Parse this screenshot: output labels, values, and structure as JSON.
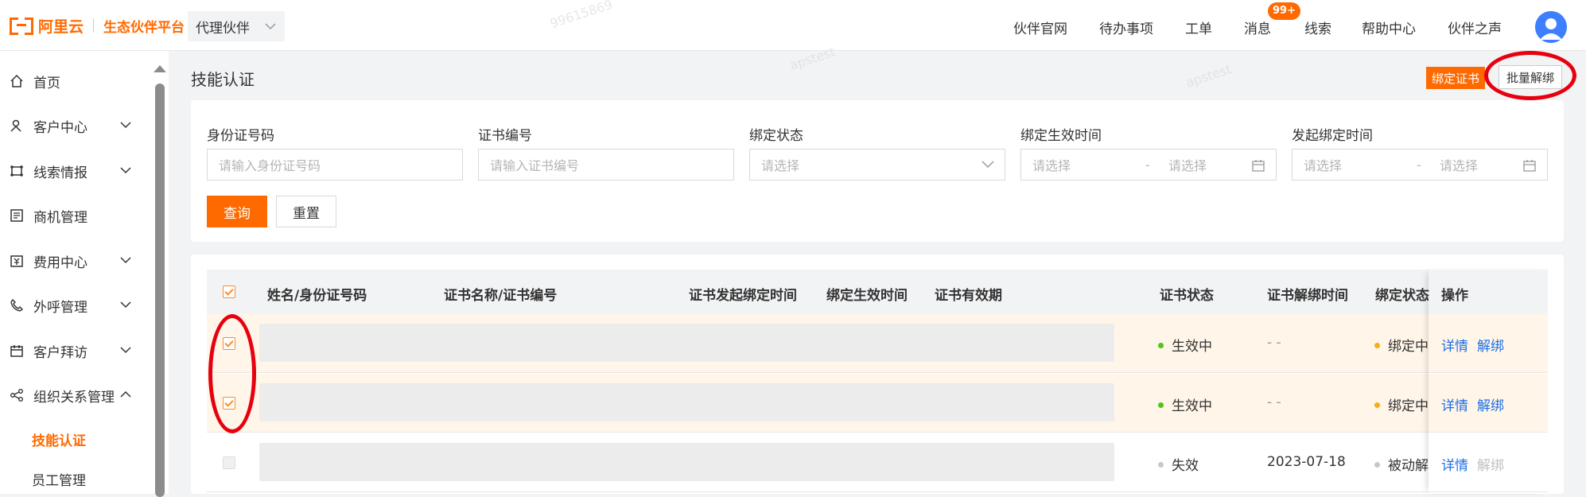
{
  "header": {
    "logo_text": "阿里云",
    "logo_sub": "生态伙伴平台",
    "role": "代理伙伴",
    "nav": [
      "伙伴官网",
      "待办事项",
      "工单",
      "消息",
      "线索",
      "帮助中心",
      "伙伴之声"
    ],
    "message_badge": "99+"
  },
  "sidebar": {
    "items": [
      {
        "label": "首页",
        "icon": "home-icon"
      },
      {
        "label": "客户中心",
        "icon": "customer-icon"
      },
      {
        "label": "线索情报",
        "icon": "lead-icon"
      },
      {
        "label": "商机管理",
        "icon": "opportunity-icon"
      },
      {
        "label": "费用中心",
        "icon": "fee-icon"
      },
      {
        "label": "外呼管理",
        "icon": "phone-icon"
      },
      {
        "label": "客户拜访",
        "icon": "calendar-icon"
      },
      {
        "label": "组织关系管理",
        "icon": "share-icon"
      }
    ],
    "sub_items": [
      "技能认证",
      "员工管理"
    ]
  },
  "page": {
    "title": "技能认证",
    "bind_cert_label": "绑定证书",
    "batch_unbind_label": "批量解绑"
  },
  "filters": {
    "id_label": "身份证号码",
    "id_placeholder": "请输入身份证号码",
    "cert_label": "证书编号",
    "cert_placeholder": "请输入证书编号",
    "status_label": "绑定状态",
    "status_placeholder": "请选择",
    "effective_label": "绑定生效时间",
    "initiate_label": "发起绑定时间",
    "range_start": "请选择",
    "range_sep": "-",
    "range_end": "请选择",
    "query_label": "查询",
    "reset_label": "重置"
  },
  "table": {
    "columns": [
      "姓名/身份证号码",
      "证书名称/证书编号",
      "证书发起绑定时间",
      "绑定生效时间",
      "证书有效期",
      "证书状态",
      "证书解绑时间",
      "绑定状态",
      "操作"
    ],
    "rows": [
      {
        "cert_status": "生效中",
        "cert_status_color": "#52c41a",
        "unbind_time": "- -",
        "bind_status": "绑定中",
        "bind_status_color": "#faad14",
        "detail": "详情",
        "unbind": "解绑",
        "selected": true
      },
      {
        "cert_status": "生效中",
        "cert_status_color": "#52c41a",
        "unbind_time": "- -",
        "bind_status": "绑定中",
        "bind_status_color": "#faad14",
        "detail": "详情",
        "unbind": "解绑",
        "selected": true
      },
      {
        "cert_status": "失效",
        "cert_status_color": "#c8c8c8",
        "unbind_time": "2023-07-18",
        "bind_status": "被动解",
        "bind_status_color": "#c8c8c8",
        "detail": "详情",
        "unbind": "解绑",
        "selected": false
      }
    ]
  },
  "colors": {
    "accent": "#ff6a00",
    "link": "#1f6fe5",
    "annotation": "#e8000f"
  }
}
